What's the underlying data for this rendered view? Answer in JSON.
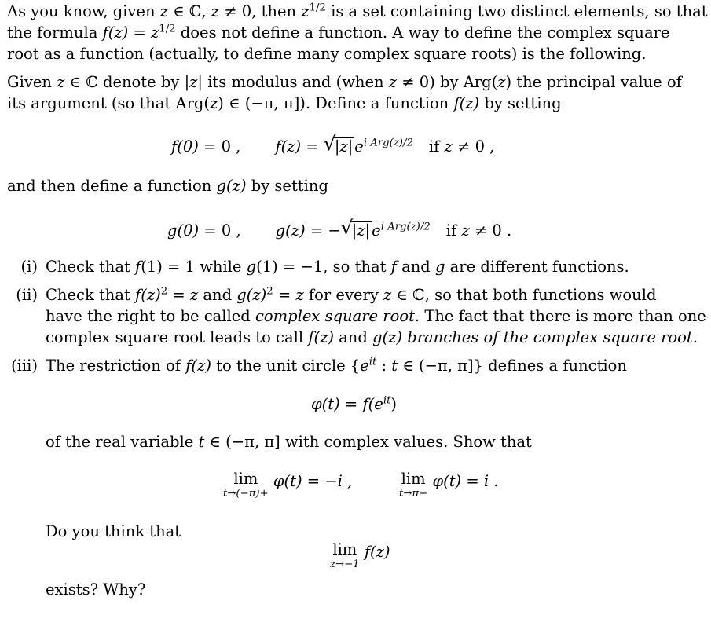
{
  "paragraph1": {
    "l1_a": "As you know, given ",
    "l1_z": "z",
    "l1_in": " ∈ ℂ, ",
    "l1_z2": "z",
    "l1_ne": " ≠ 0, then ",
    "l1_z3": "z",
    "l1_exp": "1/2",
    "l1_b": " is a set containing two distinct elements, so that",
    "l2_a": "the formula ",
    "l2_f": "f",
    "l2_arg": "(z)",
    "l2_eq": " = ",
    "l2_z": "z",
    "l2_exp": "1/2",
    "l2_b": " does not define a function.  A way to define the complex square",
    "l3": "root as a function (actually, to define many complex square roots) is the following."
  },
  "paragraph2": {
    "l1_a": "Given ",
    "l1_z": "z",
    "l1_b": " ∈ ℂ denote by |",
    "l1_z2": "z",
    "l1_c": "| its modulus and (when ",
    "l1_z3": "z",
    "l1_d": " ≠ 0) by Arg(",
    "l1_z4": "z",
    "l1_e": ") the principal value of",
    "l2_a": "its argument (so that Arg(",
    "l2_z": "z",
    "l2_b": ") ∈ (−π, π]). Define a function ",
    "l2_f": "f(z)",
    "l2_c": " by setting"
  },
  "eq_f": {
    "f0": "f(0)",
    "f0_rhs": " = 0 ,",
    "fz": "f(z)",
    "eq": " = ",
    "rad": "|z|",
    "e": "e",
    "exp": "i Arg(z)/2",
    "cond": "if ",
    "cond_z": "z",
    "cond_rest": " ≠ 0 ,"
  },
  "paragraph3": {
    "a": "and then define a function ",
    "g": "g(z)",
    "b": " by setting"
  },
  "eq_g": {
    "g0": "g(0)",
    "g0_rhs": " = 0 ,",
    "gz": "g(z)",
    "eq": " = −",
    "rad": "|z|",
    "e": "e",
    "exp": "i Arg(z)/2",
    "cond": "if ",
    "cond_z": "z",
    "cond_rest": " ≠ 0 ."
  },
  "items": [
    {
      "label": "(i)",
      "l1_a": "Check that ",
      "l1_f": "f",
      "l1_b": "(1) = 1 while ",
      "l1_g": "g",
      "l1_c": "(1) = −1, so that ",
      "l1_f2": "f",
      "l1_d": " and ",
      "l1_g2": "g",
      "l1_e": " are different functions."
    },
    {
      "label": "(ii)",
      "l1_a": "Check that ",
      "l1_f": "f(z)",
      "l1_exp": "2",
      "l1_b": " = ",
      "l1_z": "z",
      "l1_c": " and ",
      "l1_g": "g(z)",
      "l1_exp2": "2",
      "l1_d": " = ",
      "l1_z2": "z",
      "l1_e": " for every ",
      "l1_z3": "z",
      "l1_f_txt": " ∈ ℂ, so that both functions would",
      "l2_a": "have the right to be called ",
      "l2_em": "complex square root.",
      "l2_b": " The fact that there is more than one",
      "l3_a": "complex square root leads to call ",
      "l3_f": "f(z)",
      "l3_b": " and ",
      "l3_g": "g(z)",
      "l3_em": " branches of the complex square root."
    },
    {
      "label": "(iii)",
      "l1_a": "The restriction of ",
      "l1_f": "f(z)",
      "l1_b": " to the unit circle {",
      "l1_e": "e",
      "l1_exp": "it",
      "l1_c": " : ",
      "l1_t": "t",
      "l1_d": " ∈ (−π, π]} defines a function",
      "eq_lhs": "φ(t)",
      "eq_mid": " = ",
      "eq_f": "f(e",
      "eq_exp": "it",
      "eq_close": ")",
      "l2_a": "of the real variable ",
      "l2_t": "t",
      "l2_b": " ∈ (−π, π] with complex values. Show that",
      "lim1_lim": "lim",
      "lim1_below": "t→(−π)+",
      "lim1_expr": " φ(t) = −i ,",
      "lim2_lim": "lim",
      "lim2_below": "t→π−",
      "lim2_expr": " φ(t) = i .",
      "q1": "Do you think that",
      "lim3_lim": "lim",
      "lim3_below": "z→−1",
      "lim3_expr": " f(z)",
      "q2": "exists?  Why?"
    }
  ]
}
